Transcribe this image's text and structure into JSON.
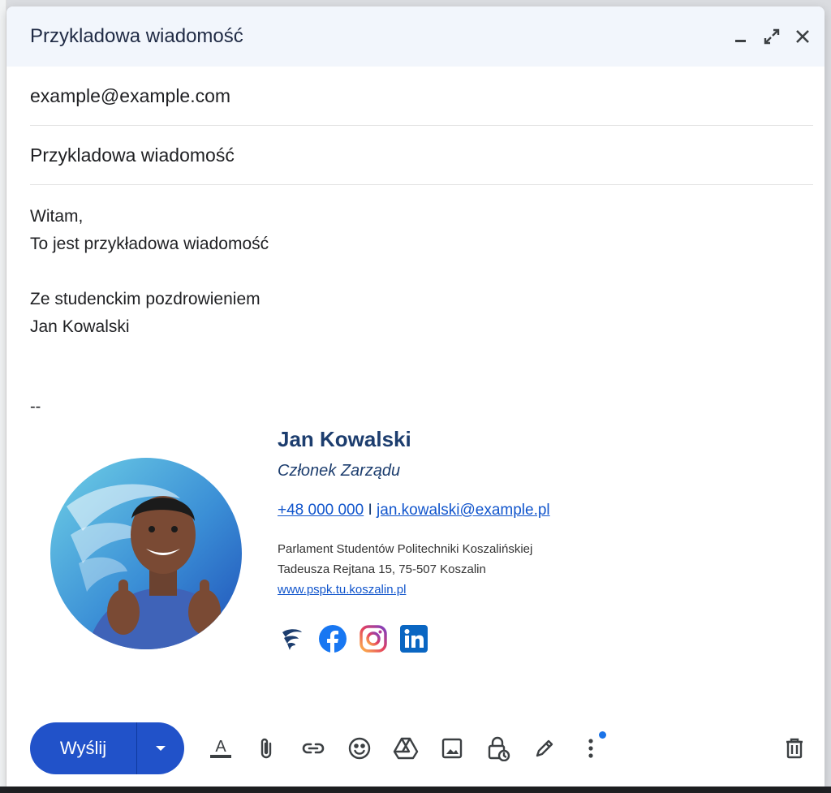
{
  "window": {
    "title": "Przykladowa wiadomość"
  },
  "header": {
    "minimize_icon": "minimize-icon",
    "expand_icon": "expand-icon",
    "close_icon": "close-icon"
  },
  "fields": {
    "to": "example@example.com",
    "subject": "Przykladowa wiadomość"
  },
  "body": {
    "greeting": "Witam,",
    "line1": "To jest przykładowa wiadomość",
    "closing": "Ze studenckim pozdrowieniem",
    "name": "Jan Kowalski",
    "sig_separator": "--"
  },
  "signature": {
    "name": "Jan Kowalski",
    "role": "Członek Zarządu",
    "phone": "+48 000 000",
    "separator": "I",
    "email": "jan.kowalski@example.pl",
    "org": "Parlament Studentów Politechniki Koszalińskiej",
    "address": "Tadeusza Rejtana 15, 75-507 Koszalin",
    "website": "www.pspk.tu.koszalin.pl",
    "social": [
      "pspk-icon",
      "facebook-icon",
      "instagram-icon",
      "linkedin-icon"
    ]
  },
  "toolbar": {
    "send_label": "Wyślij",
    "tools": [
      "format-text-icon",
      "attach-icon",
      "link-icon",
      "emoji-icon",
      "drive-icon",
      "image-icon",
      "confidential-icon",
      "signature-icon",
      "more-icon",
      "trash-icon"
    ]
  },
  "colors": {
    "accent": "#2152c9",
    "header_bg": "#f2f6fc",
    "sig_name": "#1c3d6e",
    "link": "#1155cc"
  }
}
